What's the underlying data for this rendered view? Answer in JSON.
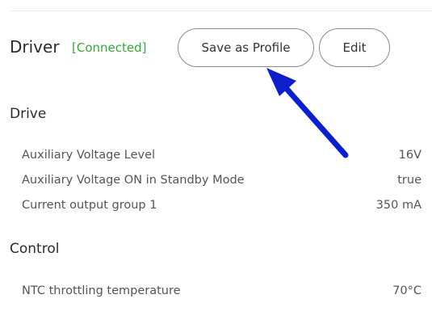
{
  "header": {
    "title": "Driver",
    "status": "[Connected]",
    "status_color": "#3aa63a",
    "save_label": "Save as Profile",
    "edit_label": "Edit"
  },
  "annotation": {
    "arrow_color": "#0d1fc9",
    "icon": "arrow-pointing-up-left"
  },
  "sections": [
    {
      "title": "Drive",
      "rows": [
        {
          "label": "Auxiliary Voltage Level",
          "value": "16V"
        },
        {
          "label": "Auxiliary Voltage ON in Standby Mode",
          "value": "true"
        },
        {
          "label": "Current output group 1",
          "value": "350 mA"
        }
      ]
    },
    {
      "title": "Control",
      "rows": [
        {
          "label": "NTC throttling temperature",
          "value": "70°C"
        }
      ]
    }
  ]
}
